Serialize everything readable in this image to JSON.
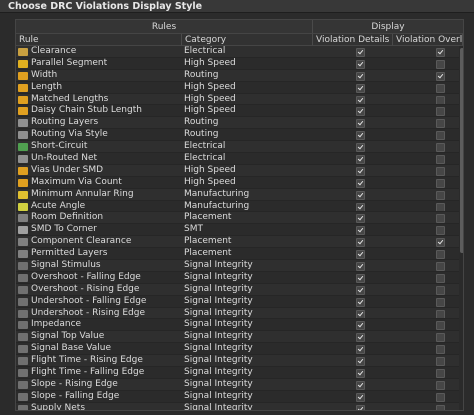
{
  "title": "Choose DRC Violations Display Style",
  "headers": {
    "group_rules": "Rules",
    "group_display": "Display",
    "rule": "Rule",
    "category": "Category",
    "violation_details": "Violation Details",
    "violation_overlay": "Violation Overlay"
  },
  "rows": [
    {
      "rule": "Clearance",
      "category": "Electrical",
      "details": true,
      "overlay": true,
      "icon": "clearance-icon",
      "color": "#c8a040"
    },
    {
      "rule": "Parallel Segment",
      "category": "High Speed",
      "details": true,
      "overlay": false,
      "icon": "parallel-segment-icon",
      "color": "#e0b020"
    },
    {
      "rule": "Width",
      "category": "Routing",
      "details": true,
      "overlay": true,
      "icon": "width-icon",
      "color": "#e0a020"
    },
    {
      "rule": "Length",
      "category": "High Speed",
      "details": true,
      "overlay": false,
      "icon": "length-icon",
      "color": "#e0a020"
    },
    {
      "rule": "Matched Lengths",
      "category": "High Speed",
      "details": true,
      "overlay": false,
      "icon": "matched-lengths-icon",
      "color": "#e0a020"
    },
    {
      "rule": "Daisy Chain Stub Length",
      "category": "High Speed",
      "details": true,
      "overlay": false,
      "icon": "daisy-chain-icon",
      "color": "#e0a020"
    },
    {
      "rule": "Routing Layers",
      "category": "Routing",
      "details": true,
      "overlay": false,
      "icon": "routing-layers-icon",
      "color": "#909090"
    },
    {
      "rule": "Routing Via Style",
      "category": "Routing",
      "details": true,
      "overlay": false,
      "icon": "routing-via-icon",
      "color": "#909090"
    },
    {
      "rule": "Short-Circuit",
      "category": "Electrical",
      "details": true,
      "overlay": false,
      "icon": "short-circuit-icon",
      "color": "#50a050"
    },
    {
      "rule": "Un-Routed Net",
      "category": "Electrical",
      "details": true,
      "overlay": false,
      "icon": "unrouted-net-icon",
      "color": "#909090"
    },
    {
      "rule": "Vias Under SMD",
      "category": "High Speed",
      "details": true,
      "overlay": false,
      "icon": "vias-under-smd-icon",
      "color": "#e0a020"
    },
    {
      "rule": "Maximum Via Count",
      "category": "High Speed",
      "details": true,
      "overlay": false,
      "icon": "max-via-count-icon",
      "color": "#e0a020"
    },
    {
      "rule": "Minimum Annular Ring",
      "category": "Manufacturing",
      "details": true,
      "overlay": false,
      "icon": "annular-ring-icon",
      "color": "#e0c030"
    },
    {
      "rule": "Acute Angle",
      "category": "Manufacturing",
      "details": true,
      "overlay": false,
      "icon": "acute-angle-icon",
      "color": "#d0d040"
    },
    {
      "rule": "Room Definition",
      "category": "Placement",
      "details": true,
      "overlay": false,
      "icon": "room-definition-icon",
      "color": "#808080"
    },
    {
      "rule": "SMD To Corner",
      "category": "SMT",
      "details": true,
      "overlay": false,
      "icon": "smd-corner-icon",
      "color": "#a0a0a0"
    },
    {
      "rule": "Component Clearance",
      "category": "Placement",
      "details": true,
      "overlay": true,
      "icon": "component-clearance-icon",
      "color": "#808080"
    },
    {
      "rule": "Permitted Layers",
      "category": "Placement",
      "details": true,
      "overlay": false,
      "icon": "permitted-layers-icon",
      "color": "#808080"
    },
    {
      "rule": "Signal Stimulus",
      "category": "Signal Integrity",
      "details": true,
      "overlay": false,
      "icon": "signal-stimulus-icon",
      "color": "#707070"
    },
    {
      "rule": "Overshoot - Falling Edge",
      "category": "Signal Integrity",
      "details": true,
      "overlay": false,
      "icon": "overshoot-falling-icon",
      "color": "#707070"
    },
    {
      "rule": "Overshoot - Rising Edge",
      "category": "Signal Integrity",
      "details": true,
      "overlay": false,
      "icon": "overshoot-rising-icon",
      "color": "#707070"
    },
    {
      "rule": "Undershoot - Falling Edge",
      "category": "Signal Integrity",
      "details": true,
      "overlay": false,
      "icon": "undershoot-falling-icon",
      "color": "#707070"
    },
    {
      "rule": "Undershoot - Rising Edge",
      "category": "Signal Integrity",
      "details": true,
      "overlay": false,
      "icon": "undershoot-rising-icon",
      "color": "#707070"
    },
    {
      "rule": "Impedance",
      "category": "Signal Integrity",
      "details": true,
      "overlay": false,
      "icon": "impedance-icon",
      "color": "#707070"
    },
    {
      "rule": "Signal Top Value",
      "category": "Signal Integrity",
      "details": true,
      "overlay": false,
      "icon": "signal-top-icon",
      "color": "#707070"
    },
    {
      "rule": "Signal Base Value",
      "category": "Signal Integrity",
      "details": true,
      "overlay": false,
      "icon": "signal-base-icon",
      "color": "#707070"
    },
    {
      "rule": "Flight Time - Rising Edge",
      "category": "Signal Integrity",
      "details": true,
      "overlay": false,
      "icon": "flight-time-rising-icon",
      "color": "#707070"
    },
    {
      "rule": "Flight Time - Falling Edge",
      "category": "Signal Integrity",
      "details": true,
      "overlay": false,
      "icon": "flight-time-falling-icon",
      "color": "#707070"
    },
    {
      "rule": "Slope - Rising Edge",
      "category": "Signal Integrity",
      "details": true,
      "overlay": false,
      "icon": "slope-rising-icon",
      "color": "#707070"
    },
    {
      "rule": "Slope - Falling Edge",
      "category": "Signal Integrity",
      "details": true,
      "overlay": false,
      "icon": "slope-falling-icon",
      "color": "#707070"
    },
    {
      "rule": "Supply Nets",
      "category": "Signal Integrity",
      "details": true,
      "overlay": false,
      "icon": "supply-nets-icon",
      "color": "#707070"
    }
  ]
}
